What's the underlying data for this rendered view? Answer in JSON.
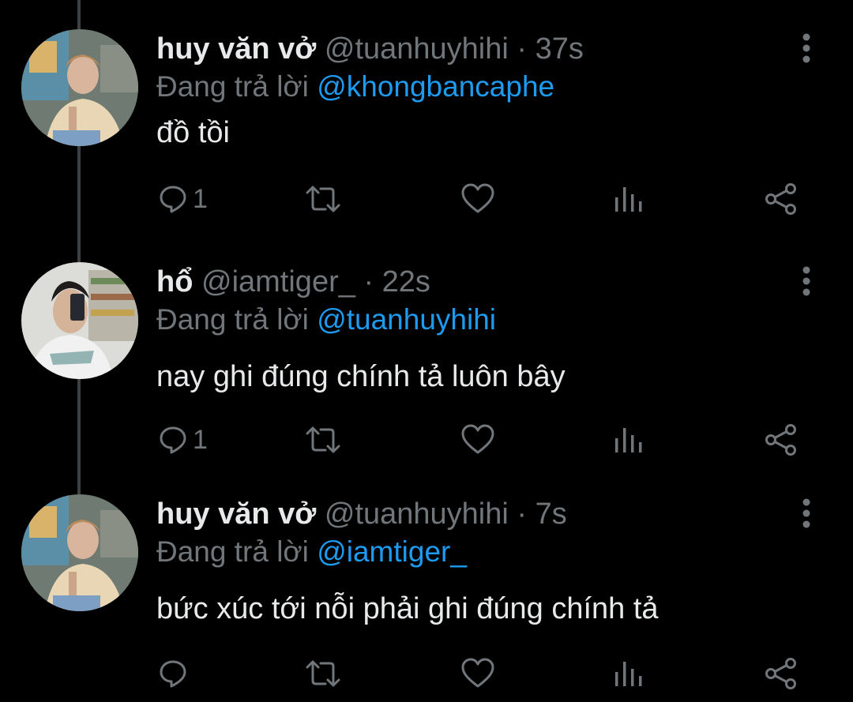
{
  "colors": {
    "background": "#000000",
    "text_primary": "#e7e9ea",
    "text_secondary": "#71767b",
    "mention": "#1d9bf0",
    "thread_line": "#3e4144"
  },
  "tweets": [
    {
      "display_name": "huy văn vở",
      "handle": "@tuanhuyhihi",
      "separator": "·",
      "time": "37s",
      "reply_prefix": "Đang trả lời",
      "reply_to": "@khongbancaphe",
      "text": "đồ tồi",
      "reply_count": "1",
      "avatar_icon": "avatar-photo"
    },
    {
      "display_name": "hổ",
      "handle": "@iamtiger_",
      "separator": "·",
      "time": "22s",
      "reply_prefix": "Đang trả lời",
      "reply_to": "@tuanhuyhihi",
      "text": "nay ghi đúng chính tả luôn bây",
      "reply_count": "1",
      "avatar_icon": "avatar-photo"
    },
    {
      "display_name": "huy văn vở",
      "handle": "@tuanhuyhihi",
      "separator": "·",
      "time": "7s",
      "reply_prefix": "Đang trả lời",
      "reply_to": "@iamtiger_",
      "text": "bức xúc tới nỗi phải ghi đúng chính tả",
      "reply_count": "",
      "avatar_icon": "avatar-photo"
    }
  ],
  "icons": {
    "reply": "reply-icon",
    "retweet": "retweet-icon",
    "like": "heart-icon",
    "views": "analytics-icon",
    "share": "share-icon",
    "more": "more-vertical-icon"
  }
}
